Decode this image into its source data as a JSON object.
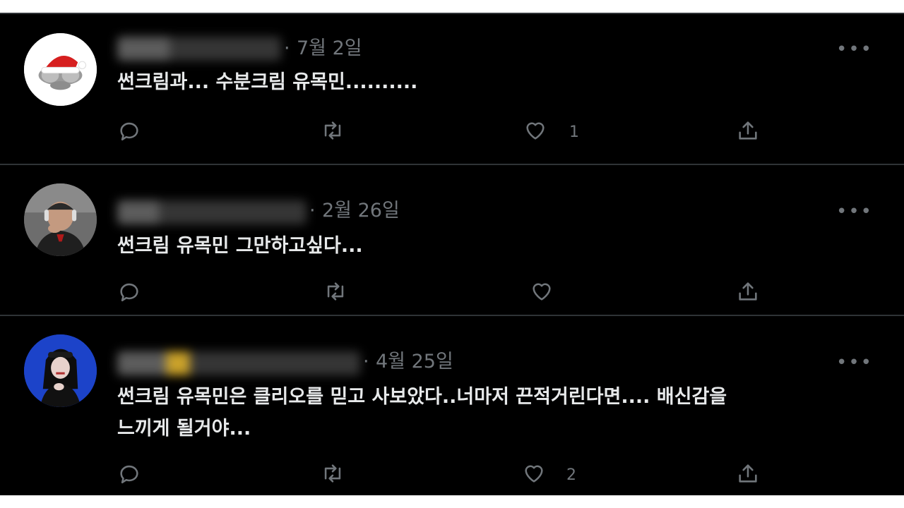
{
  "tweets": [
    {
      "date": "7월 2일",
      "text": "썬크림과... 수분크림 유목민..........",
      "likes": "1",
      "avatar_icon": "santa-hat-avatar-icon"
    },
    {
      "date": "2월 26일",
      "text": "썬크림 유목민 그만하고싶다...",
      "likes": "",
      "avatar_icon": "person-headphones-avatar-icon"
    },
    {
      "date": "4월 25일",
      "text": "썬크림 유목민은 클리오를 믿고 사보았다..너마저 끈적거린다면.... 배신감을\n느끼게 될거야...",
      "likes": "2",
      "avatar_icon": "person-blue-background-avatar-icon"
    }
  ],
  "meta_separator": "·",
  "more_label": "•••",
  "colors": {
    "background": "#000000",
    "text": "#e7e9ea",
    "muted": "#71767b",
    "divider": "#2f3336"
  }
}
